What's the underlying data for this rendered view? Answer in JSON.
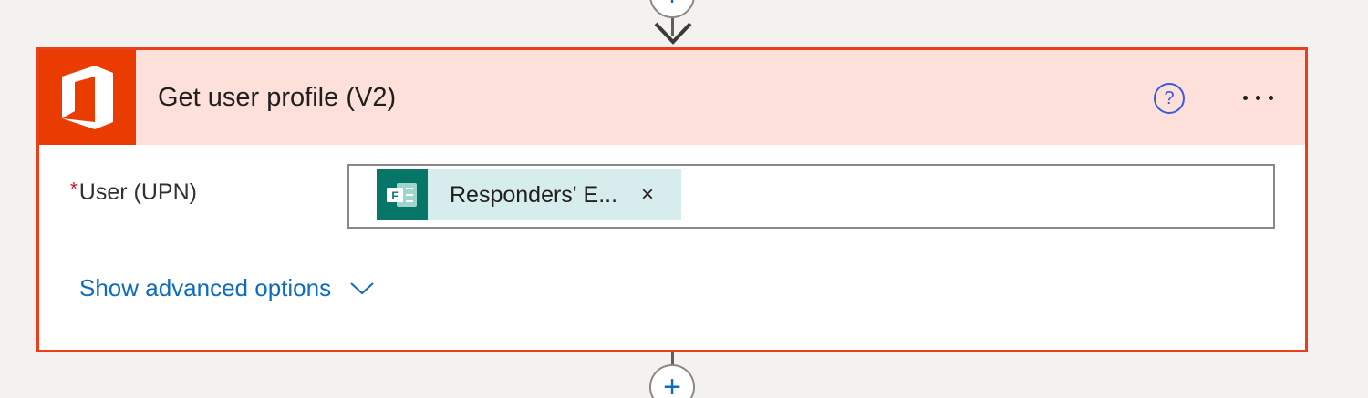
{
  "flow": {
    "add_step_symbol": "+"
  },
  "action": {
    "title": "Get user profile (V2)",
    "icon": "office-icon",
    "accent_color": "#eb3c00",
    "header_bg": "#fce0d9",
    "border_color": "#e8401b",
    "help_symbol": "?",
    "more_icon": "ellipsis-icon"
  },
  "fields": [
    {
      "required_marker": "*",
      "label": "User (UPN)",
      "token": {
        "icon": "forms-icon",
        "text": "Responders' E...",
        "remove_symbol": "×"
      }
    }
  ],
  "advanced": {
    "label": "Show advanced options",
    "icon": "chevron-down-icon"
  }
}
